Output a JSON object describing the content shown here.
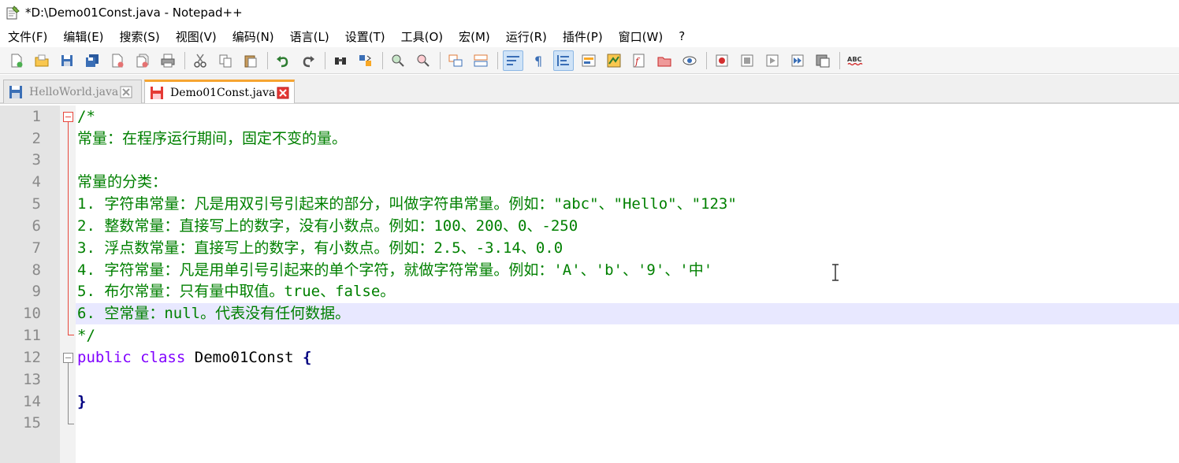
{
  "window": {
    "title": "*D:\\Demo01Const.java - Notepad++",
    "app_icon": "notepad-plus-plus-icon"
  },
  "menu": {
    "items": [
      "文件(F)",
      "编辑(E)",
      "搜索(S)",
      "视图(V)",
      "编码(N)",
      "语言(L)",
      "设置(T)",
      "工具(O)",
      "宏(M)",
      "运行(R)",
      "插件(P)",
      "窗口(W)",
      "?"
    ]
  },
  "toolbar": {
    "buttons": [
      {
        "name": "new-file-icon"
      },
      {
        "name": "open-file-icon"
      },
      {
        "name": "save-icon"
      },
      {
        "name": "save-all-icon"
      },
      {
        "name": "close-icon"
      },
      {
        "name": "close-all-icon"
      },
      {
        "name": "print-icon"
      },
      {
        "name": "cut-icon"
      },
      {
        "name": "copy-icon"
      },
      {
        "name": "paste-icon"
      },
      {
        "name": "undo-icon"
      },
      {
        "name": "redo-icon"
      },
      {
        "name": "find-icon"
      },
      {
        "name": "replace-icon"
      },
      {
        "name": "zoom-in-icon"
      },
      {
        "name": "zoom-out-icon"
      },
      {
        "name": "sync-vertical-icon"
      },
      {
        "name": "sync-horizontal-icon"
      },
      {
        "name": "word-wrap-icon"
      },
      {
        "name": "show-all-characters-icon"
      },
      {
        "name": "indent-guide-icon"
      },
      {
        "name": "user-defined-language-icon"
      },
      {
        "name": "document-map-icon"
      },
      {
        "name": "function-list-icon"
      },
      {
        "name": "folder-as-workspace-icon"
      },
      {
        "name": "monitoring-icon"
      },
      {
        "name": "record-macro-icon"
      },
      {
        "name": "stop-record-icon"
      },
      {
        "name": "playback-macro-icon"
      },
      {
        "name": "run-macro-multiple-icon"
      },
      {
        "name": "save-macro-icon"
      },
      {
        "name": "spell-check-icon"
      }
    ],
    "spell_check_label": "ABC"
  },
  "tabs": [
    {
      "label": "HelloWorld.java",
      "active": false
    },
    {
      "label": "Demo01Const.java",
      "active": true
    }
  ],
  "editor": {
    "line_numbers": [
      "1",
      "2",
      "3",
      "4",
      "5",
      "6",
      "7",
      "8",
      "9",
      "10",
      "11",
      "12",
      "13",
      "14",
      "15"
    ],
    "current_line": 10,
    "lines": {
      "l1": "/*",
      "l2": "常量：在程序运行期间，固定不变的量。",
      "l3": "",
      "l4": "常量的分类：",
      "l5": "1. 字符串常量：凡是用双引号引起来的部分，叫做字符串常量。例如：\"abc\"、\"Hello\"、\"123\"",
      "l6": "2. 整数常量：直接写上的数字，没有小数点。例如：100、200、0、-250",
      "l7": "3. 浮点数常量：直接写上的数字，有小数点。例如：2.5、-3.14、0.0",
      "l8": "4. 字符常量：凡是用单引号引起来的单个字符，就做字符常量。例如：'A'、'b'、'9'、'中'",
      "l9": "5. 布尔常量：只有量中取值。true、false。",
      "l10": "6. 空常量：null。代表没有任何数据。",
      "l11": "*/",
      "l12_kw1": "public",
      "l12_kw2": "class",
      "l12_name": "Demo01Const",
      "l12_brace": "{",
      "l13": "",
      "l14_brace": "}",
      "l15": ""
    }
  },
  "colors": {
    "comment": "#008000",
    "keyword": "#000080",
    "keyword2": "#8000ff",
    "current_line_bg": "#e8e8ff",
    "fold_marker": "#e8473c",
    "active_tab_accent": "#f6a531"
  }
}
